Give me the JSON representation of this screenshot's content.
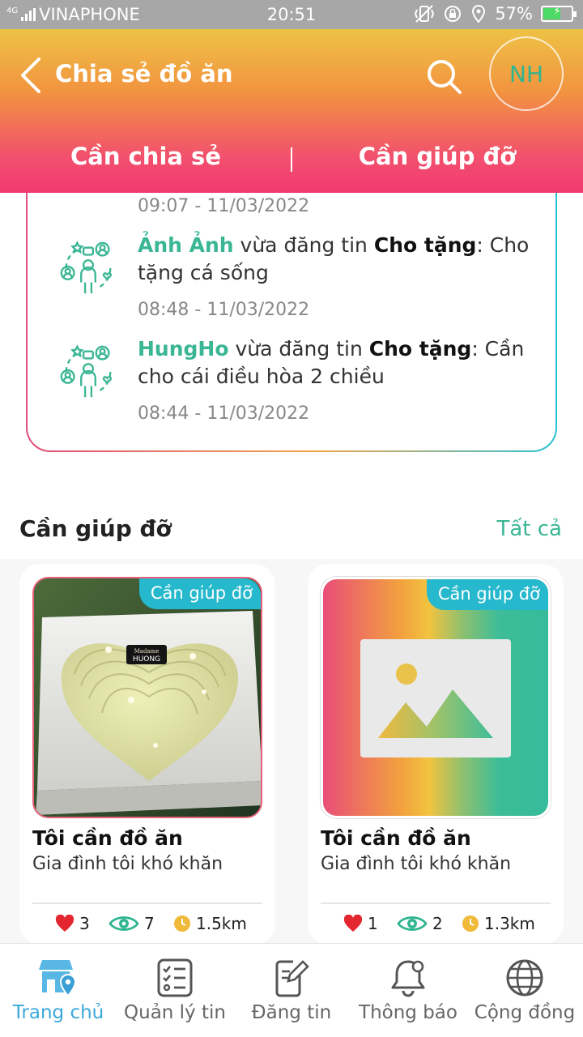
{
  "status_bar": {
    "signal_label": "4G",
    "carrier": "VINAPHONE",
    "time": "20:51",
    "battery": "57%",
    "battery_level": 0.57
  },
  "header": {
    "title": "Chia sẻ đồ ăn",
    "avatar_initials": "NH",
    "tabs": [
      {
        "label": "Cần chia sẻ"
      },
      {
        "label": "Cần giúp đỡ"
      }
    ]
  },
  "activity": {
    "items": [
      {
        "time": "09:07 - 11/03/2022"
      },
      {
        "user": "Ảnh Ảnh",
        "verb": " vừa đăng tin ",
        "type": "Cho tặng",
        "message": ": Cho tặng cá sống",
        "time": "08:48 - 11/03/2022"
      },
      {
        "user": "HungHo",
        "verb": " vừa đăng tin ",
        "type": "Cho tặng",
        "message": ": Cần cho cái điều hòa 2 chiều",
        "time": "08:44 - 11/03/2022"
      }
    ]
  },
  "section": {
    "title": "Cần giúp đỡ",
    "see_all": "Tất cả"
  },
  "cards": [
    {
      "badge": "Cần giúp đỡ",
      "cake_label_1": "Madame",
      "cake_label_2": "HUONG",
      "title": "Tôi cần đồ ăn",
      "subtitle": "Gia đình tôi khó khăn",
      "likes": "3",
      "views": "7",
      "distance": "1.5km"
    },
    {
      "badge": "Cần giúp đỡ",
      "title": "Tôi cần đồ ăn",
      "subtitle": "Gia đình tôi khó khăn",
      "likes": "1",
      "views": "2",
      "distance": "1.3km"
    }
  ],
  "bottom_nav": [
    {
      "label": "Trang chủ",
      "icon": "home-store-icon",
      "active": true
    },
    {
      "label": "Quản lý tin",
      "icon": "checklist-icon",
      "active": false
    },
    {
      "label": "Đăng tin",
      "icon": "edit-document-icon",
      "active": false
    },
    {
      "label": "Thông báo",
      "icon": "bell-icon",
      "active": false
    },
    {
      "label": "Cộng đồng",
      "icon": "globe-icon",
      "active": false
    }
  ],
  "colors": {
    "accent_green": "#3bb694",
    "badge_cyan": "#26b8cc",
    "nav_active": "#3aa9dc",
    "header_top": "#eec245",
    "header_bottom": "#f23a72"
  }
}
